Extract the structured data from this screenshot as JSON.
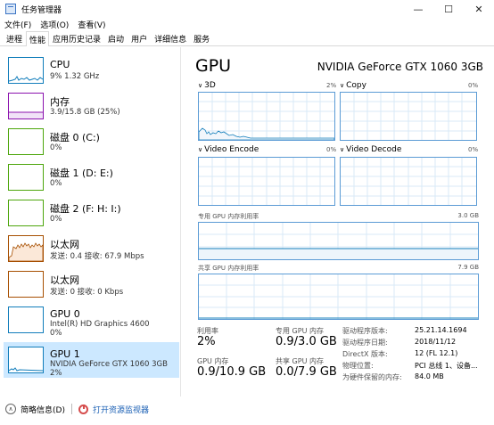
{
  "window": {
    "title": "任务管理器",
    "minimize_glyph": "—",
    "maximize_glyph": "☐",
    "close_glyph": "✕"
  },
  "menu": [
    "文件(F)",
    "选项(O)",
    "查看(V)"
  ],
  "tabs": [
    "进程",
    "性能",
    "应用历史记录",
    "启动",
    "用户",
    "详细信息",
    "服务"
  ],
  "active_tab": "性能",
  "sidebar": {
    "items": [
      {
        "name": "CPU",
        "lines": [
          "9% 1.32 GHz"
        ],
        "color": "#117dbb",
        "active": false
      },
      {
        "name": "内存",
        "lines": [
          "3.9/15.8 GB (25%)"
        ],
        "color": "#8b12ae",
        "active": false
      },
      {
        "name": "磁盘 0 (C:)",
        "lines": [
          "0%"
        ],
        "color": "#4da60c",
        "active": false
      },
      {
        "name": "磁盘 1 (D: E:)",
        "lines": [
          "0%"
        ],
        "color": "#4da60c",
        "active": false
      },
      {
        "name": "磁盘 2 (F: H: I:)",
        "lines": [
          "0%"
        ],
        "color": "#4da60c",
        "active": false
      },
      {
        "name": "以太网",
        "lines": [
          "发送: 0.4 接收: 67.9 Mbps"
        ],
        "color": "#a74f01",
        "active": false
      },
      {
        "name": "以太网",
        "lines": [
          "发送: 0 接收: 0 Kbps"
        ],
        "color": "#a74f01",
        "active": false
      },
      {
        "name": "GPU 0",
        "lines": [
          "Intel(R) HD Graphics 4600",
          "0%"
        ],
        "color": "#117dbb",
        "active": false
      },
      {
        "name": "GPU 1",
        "lines": [
          "NVIDIA GeForce GTX 1060 3GB",
          "2%"
        ],
        "color": "#117dbb",
        "active": true
      }
    ]
  },
  "main": {
    "title": "GPU",
    "model": "NVIDIA GeForce GTX 1060 3GB",
    "engines": [
      {
        "name": "3D",
        "percent": "2%"
      },
      {
        "name": "Copy",
        "percent": "0%"
      },
      {
        "name": "Video Encode",
        "percent": "0%"
      },
      {
        "name": "Video Decode",
        "percent": "0%"
      }
    ],
    "dedicated_mem_label": "专用 GPU 内存利用率",
    "dedicated_mem_max": "3.0 GB",
    "shared_mem_label": "共享 GPU 内存利用率",
    "shared_mem_max": "7.9 GB",
    "stats": {
      "utilization_label": "利用率",
      "utilization_value": "2%",
      "dedicated_label": "专用 GPU 内存",
      "dedicated_value": "0.9/3.0 GB",
      "gpu_mem_label": "GPU 内存",
      "gpu_mem_value": "0.9/10.9 GB",
      "shared_label": "共享 GPU 内存",
      "shared_value": "0.0/7.9 GB"
    },
    "info": [
      {
        "key": "驱动程序版本:",
        "value": "25.21.14.1694"
      },
      {
        "key": "驱动程序日期:",
        "value": "2018/11/12"
      },
      {
        "key": "DirectX 版本:",
        "value": "12 (FL 12.1)"
      },
      {
        "key": "物理位置:",
        "value": "PCI 总线 1、设备..."
      },
      {
        "key": "为硬件保留的内存:",
        "value": "84.0 MB"
      }
    ]
  },
  "footer": {
    "less_details": "简略信息(D)",
    "open_monitor": "打开资源监视器"
  },
  "colors": {
    "accent": "#117dbb",
    "graph_border": "#5b9bd5",
    "grid": "#d9eaf7",
    "selected": "#cce8ff",
    "link": "#1a5fb4"
  }
}
